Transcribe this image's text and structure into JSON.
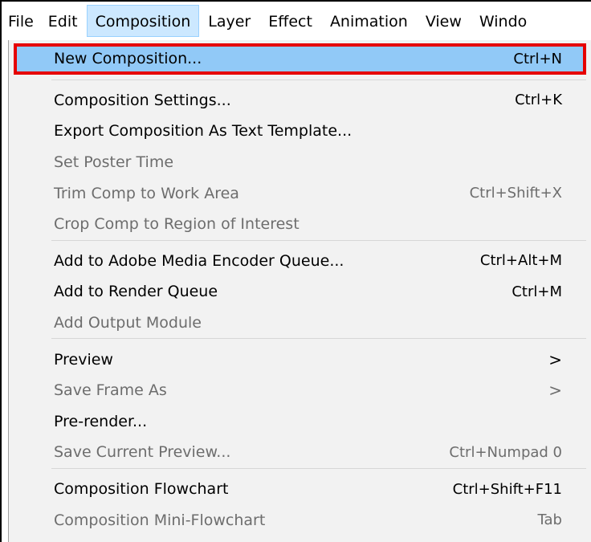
{
  "menubar": {
    "items": [
      {
        "label": "File"
      },
      {
        "label": "Edit"
      },
      {
        "label": "Composition"
      },
      {
        "label": "Layer"
      },
      {
        "label": "Effect"
      },
      {
        "label": "Animation"
      },
      {
        "label": "View"
      },
      {
        "label": "Windo"
      }
    ],
    "active_index": 2
  },
  "menu": {
    "groups": [
      [
        {
          "label": "New Composition...",
          "shortcut": "Ctrl+N",
          "enabled": true,
          "highlighted": true
        }
      ],
      [
        {
          "label": "Composition Settings...",
          "shortcut": "Ctrl+K",
          "enabled": true
        },
        {
          "label": "Export Composition As Text Template...",
          "shortcut": "",
          "enabled": true
        },
        {
          "label": "Set Poster Time",
          "shortcut": "",
          "enabled": false
        },
        {
          "label": "Trim Comp to Work Area",
          "shortcut": "Ctrl+Shift+X",
          "enabled": false
        },
        {
          "label": "Crop Comp to Region of Interest",
          "shortcut": "",
          "enabled": false
        }
      ],
      [
        {
          "label": "Add to Adobe Media Encoder Queue...",
          "shortcut": "Ctrl+Alt+M",
          "enabled": true
        },
        {
          "label": "Add to Render Queue",
          "shortcut": "Ctrl+M",
          "enabled": true
        },
        {
          "label": "Add Output Module",
          "shortcut": "",
          "enabled": false
        }
      ],
      [
        {
          "label": "Preview",
          "shortcut": "",
          "enabled": true,
          "submenu": true
        },
        {
          "label": "Save Frame As",
          "shortcut": "",
          "enabled": false,
          "submenu": true
        },
        {
          "label": "Pre-render...",
          "shortcut": "",
          "enabled": true
        },
        {
          "label": "Save Current Preview...",
          "shortcut": "Ctrl+Numpad 0",
          "enabled": false
        }
      ],
      [
        {
          "label": "Composition Flowchart",
          "shortcut": "Ctrl+Shift+F11",
          "enabled": true
        },
        {
          "label": "Composition Mini-Flowchart",
          "shortcut": "Tab",
          "enabled": false
        }
      ]
    ],
    "submenu_glyph": ">"
  },
  "colors": {
    "menu_bg": "#f2f2f2",
    "active_menubar_bg": "#cce8ff",
    "highlight_bg": "#91c9f7",
    "highlight_outline": "#e60000",
    "disabled_text": "#6d6d6d"
  }
}
